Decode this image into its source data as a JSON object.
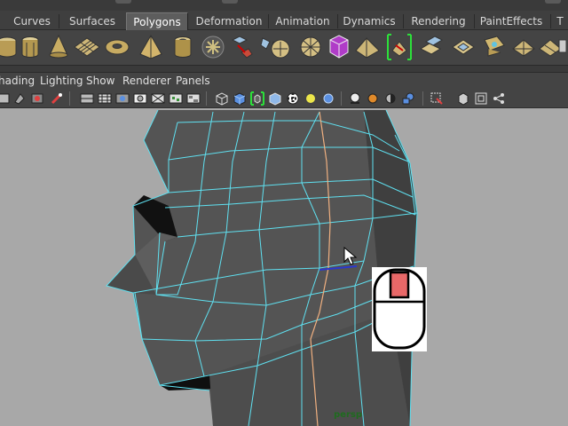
{
  "shelf_tabs": [
    {
      "label": "Curves",
      "active": false
    },
    {
      "label": "Surfaces",
      "active": false
    },
    {
      "label": "Polygons",
      "active": true
    },
    {
      "label": "Deformation",
      "active": false
    },
    {
      "label": "Animation",
      "active": false
    },
    {
      "label": "Dynamics",
      "active": false
    },
    {
      "label": "Rendering",
      "active": false
    },
    {
      "label": "PaintEffects",
      "active": false
    },
    {
      "label": "T",
      "active": false
    }
  ],
  "shelf_icons": [
    "poly-cylinder-partial-icon",
    "poly-cylinder-icon",
    "poly-cone-icon",
    "poly-plane-icon",
    "poly-torus-icon",
    "poly-pyramid-icon",
    "poly-pipe-icon",
    "poly-helix-icon",
    "separate-icon",
    "combine-icon",
    "boolean-icon",
    "smooth-proxy-icon",
    "subdivide-icon",
    "polygon-select-icon",
    "wedge-icon",
    "extrude-face-icon",
    "extrude-edge-icon",
    "merge-vertices-icon",
    "poke-face-icon",
    "split-polygon-icon"
  ],
  "panel_menus": [
    "hading",
    "Lighting",
    "Show",
    "Renderer",
    "Panels"
  ],
  "panel_toolbar_icons": [
    "select-camera-icon",
    "camera-attributes-icon",
    "bookmark-icon",
    "image-plane-icon",
    "grid-icon",
    "film-gate-icon",
    "resolution-gate-icon",
    "gate-mask-icon",
    "field-chart-icon",
    "safe-action-icon",
    "safe-title-icon",
    "wireframe-icon",
    "smooth-shade-icon",
    "wireframe-on-shaded-icon",
    "xray-icon",
    "textured-icon",
    "default-lighting-icon",
    "all-lights-icon",
    "shadows-icon",
    "isolate-select-icon",
    "xray-joints-icon",
    "backface-icon",
    "manipulator-icon",
    "hud-icon",
    "frame-icon",
    "trax-icon"
  ],
  "viewport": {
    "camera_label": "persp",
    "background": "#a8a8a8",
    "wire_color": "#5fe0f0",
    "selected_edge_color": "#2a38d0",
    "seam_color": "#f0b080",
    "mesh_color": "#525252"
  },
  "mouse_overlay": {
    "button_pressed": "left",
    "highlight_color": "#e86868"
  }
}
